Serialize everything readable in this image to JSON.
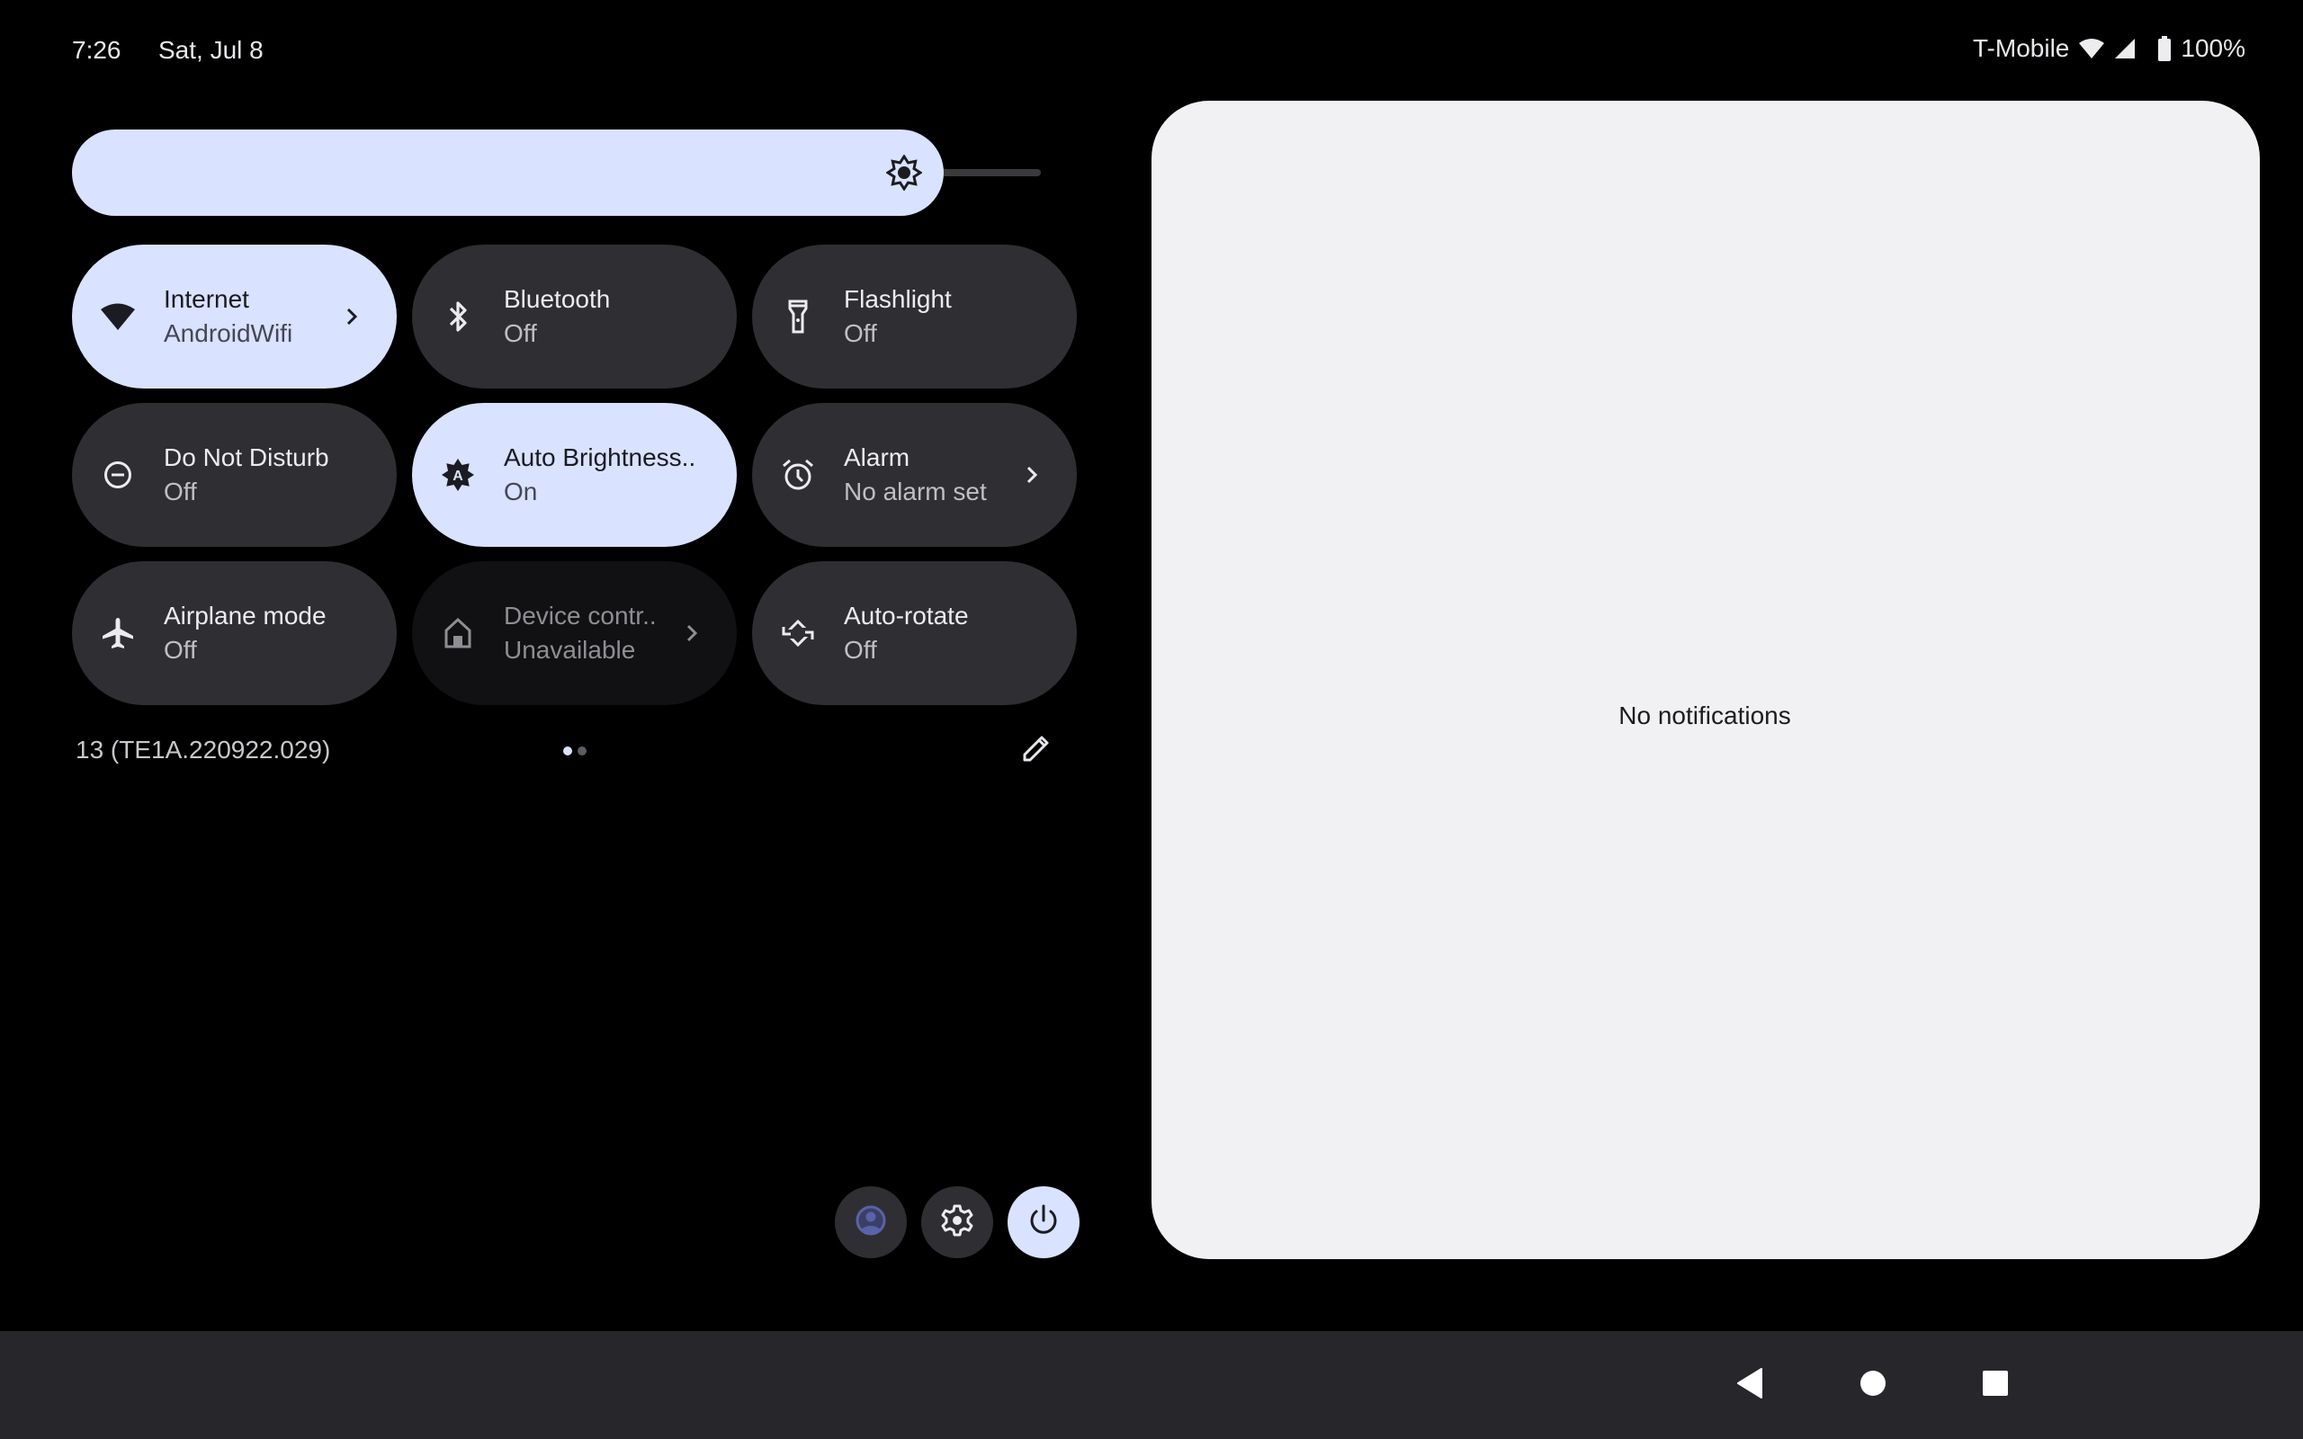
{
  "status_bar": {
    "time": "7:26",
    "date": "Sat, Jul 8",
    "carrier": "T-Mobile",
    "icons": [
      "wifi-icon",
      "cellular-signal-icon",
      "battery-icon"
    ],
    "battery_percent": "100%"
  },
  "brightness": {
    "level": 0.9,
    "icon": "brightness-icon"
  },
  "tiles": [
    {
      "label": "Internet",
      "state": "AndroidWifi",
      "icon": "wifi-icon",
      "active": true,
      "chevron": true
    },
    {
      "label": "Bluetooth",
      "state": "Off",
      "icon": "bluetooth-icon",
      "active": false,
      "chevron": false
    },
    {
      "label": "Flashlight",
      "state": "Off",
      "icon": "flashlight-icon",
      "active": false,
      "chevron": false
    },
    {
      "label": "Do Not Disturb",
      "state": "Off",
      "icon": "do-not-disturb-icon",
      "active": false,
      "chevron": false
    },
    {
      "label": "Auto Brightness..",
      "state": "On",
      "icon": "auto-brightness-icon",
      "active": true,
      "chevron": false
    },
    {
      "label": "Alarm",
      "state": "No alarm set",
      "icon": "alarm-icon",
      "active": false,
      "chevron": true
    },
    {
      "label": "Airplane mode",
      "state": "Off",
      "icon": "airplane-icon",
      "active": false,
      "chevron": false
    },
    {
      "label": "Device contr..",
      "state": "Unavailable",
      "icon": "home-icon",
      "active": false,
      "unavailable": true,
      "chevron": true
    },
    {
      "label": "Auto-rotate",
      "state": "Off",
      "icon": "auto-rotate-icon",
      "active": false,
      "chevron": false
    }
  ],
  "footer": {
    "build": "13 (TE1A.220922.029)",
    "pages": 2,
    "current_page": 1,
    "edit_icon": "pencil-icon"
  },
  "actions": {
    "user_icon": "user-icon",
    "settings_icon": "gear-icon",
    "power_icon": "power-icon"
  },
  "notifications": {
    "empty_text": "No notifications"
  },
  "nav": {
    "back_icon": "back-icon",
    "home_icon": "home-circle-icon",
    "recents_icon": "recents-icon"
  },
  "colors": {
    "accent": "#d9e2ff",
    "tile_bg": "#2f2f33",
    "panel_bg": "#f1f0f3",
    "nav_bg": "#27272b"
  }
}
